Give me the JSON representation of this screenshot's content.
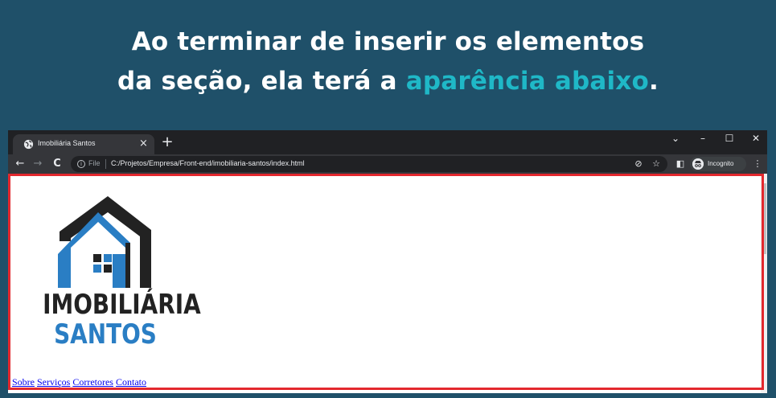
{
  "headline": {
    "line1": "Ao terminar de inserir os elementos",
    "line2_prefix": "da seção, ela terá a ",
    "line2_accent": "aparência abaixo",
    "line2_suffix": "."
  },
  "browser": {
    "tab_title": "Imobiliária Santos",
    "tab_close": "×",
    "new_tab": "+",
    "window_controls": {
      "dropdown": "⌄",
      "minimize": "–",
      "maximize": "☐",
      "close": "✕"
    },
    "nav": {
      "back": "←",
      "forward": "→",
      "reload": "C"
    },
    "omnibox": {
      "info_glyph": "i",
      "scheme": "File",
      "url": "C:/Projetos/Empresa/Front-end/imobiliaria-santos/index.html"
    },
    "icons": {
      "eye_off": "⊘",
      "star": "☆",
      "sidepanel": "◧",
      "menu": "⋮"
    },
    "incognito_label": "Incognito"
  },
  "page": {
    "logo": {
      "line1": "IMOBILIÁRIA",
      "line2": "SANTOS"
    },
    "nav_links": [
      "Sobre",
      "Serviços",
      "Corretores",
      "Contato"
    ]
  },
  "colors": {
    "background": "#1f5069",
    "accent": "#1fb8c7",
    "highlight_border": "#e3282e",
    "logo_blue": "#2a7ec4",
    "logo_dark": "#222222"
  }
}
